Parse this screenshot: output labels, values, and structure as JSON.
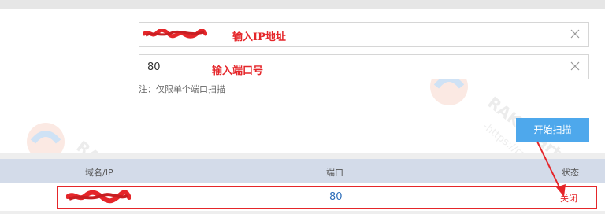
{
  "form": {
    "ip_value_redacted": true,
    "ip_annotation": "输入IP地址",
    "port_value": "80",
    "port_annotation": "输入端口号",
    "note": "注：仅限单个端口扫描",
    "scan_button": "开始扫描"
  },
  "table": {
    "columns": [
      "域名/IP",
      "端口",
      "状态"
    ],
    "rows": [
      {
        "domain_redacted": true,
        "port": "80",
        "status": "关闭"
      }
    ]
  },
  "watermark": {
    "brand": "RAKsmart",
    "url": "-https://raks"
  },
  "colors": {
    "accent": "#4ea8ec",
    "annotation_red": "#e5262a",
    "header_bg": "#d3dbe9",
    "port_blue": "#2f6fba"
  },
  "icons": {
    "clear": "close-icon",
    "arrow": "annotation-arrow"
  }
}
